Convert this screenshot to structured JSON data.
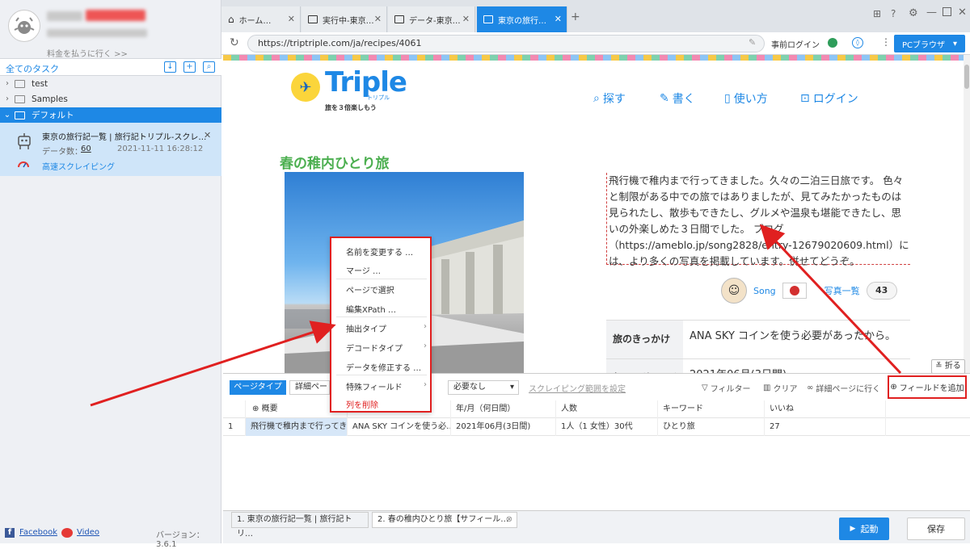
{
  "sidebar": {
    "pay_label": "料金を払うに行く >>",
    "tasks_title": "全てのタスク",
    "folders": [
      {
        "label": "test",
        "expanded": false
      },
      {
        "label": "Samples",
        "expanded": false
      },
      {
        "label": "デフォルト",
        "expanded": true,
        "selected": true
      }
    ],
    "task": {
      "title": "東京の旅行記一覧 | 旅行記トリプル-スクレ…",
      "count_label": "データ数：",
      "count": "60",
      "date": "2021-11-11 16:28:12",
      "mode": "高速スクレイピング"
    },
    "facebook": "Facebook",
    "video": "Video",
    "version": "バージョン：3.6.1"
  },
  "browser": {
    "tabs": [
      {
        "label": "ホーム…",
        "icon": "home-icon",
        "active": false
      },
      {
        "label": "実行中-東京…",
        "icon": "window-icon",
        "active": false
      },
      {
        "label": "データ-東京…",
        "icon": "window-icon",
        "active": false
      },
      {
        "label": "東京の旅行…",
        "icon": "window-icon",
        "active": true
      }
    ],
    "url": "https://triptriple.com/ja/recipes/4061",
    "pre_login": "事前ログイン",
    "browser_mode": "PCブラウザ"
  },
  "webpage": {
    "logo_text": "Triple",
    "logo_sub": "トリプル",
    "logo_tagline": "旅を３倍楽しもう",
    "nav": [
      {
        "label": "探す",
        "icon": "search-icon"
      },
      {
        "label": "書く",
        "icon": "pencil-icon"
      },
      {
        "label": "使い方",
        "icon": "book-icon"
      },
      {
        "label": "ログイン",
        "icon": "lock-icon"
      }
    ],
    "title": "春の稚内ひとり旅",
    "description": "飛行機で稚内まで行ってきました。久々の二泊三日旅です。 色々と制限がある中での旅ではありましたが、見てみたかったものは見られたし、散歩もできたし、グルメや温泉も堪能できたし、思いの外楽しめた３日間でした。 ブログ（https://ameblo.jp/song2828/entry-12679020609.html）には、より多くの写真を掲載しています。併せてどうぞ。",
    "author": "Song",
    "photo_list": "写真一覧",
    "photo_count": "43",
    "info": [
      {
        "key": "旅のきっかけ",
        "value": "ANA SKY コインを使う必要があったから。"
      },
      {
        "key": "年/月（何日間）",
        "value": "2021年06月(3日間)"
      }
    ],
    "fold": "折る"
  },
  "toolbar": {
    "page_type": "ページタイプ",
    "detail_select": "詳細ペー",
    "need_select": "必要なし",
    "scrape_range": "スクレイピング範囲を設定",
    "filter": "フィルター",
    "clear": "クリア",
    "goto_detail": "詳細ページに行く",
    "add_field": "フィールドを追加"
  },
  "context_menu": {
    "items": [
      "名前を変更する …",
      "マージ …",
      "ページで選択",
      "編集XPath …",
      "抽出タイプ",
      "デコードタイプ",
      "データを修正する …",
      "特殊フィールド",
      "列を削除"
    ]
  },
  "grid": {
    "headers": [
      "概要",
      "",
      "年/月（何日間）",
      "人数",
      "キーワード",
      "いいね"
    ],
    "rows": [
      {
        "num": "1",
        "cells": [
          "飛行機で稚内まで行ってき…",
          "ANA SKY コインを使う必…",
          "2021年06月(3日間)",
          "1人（1 女性）30代",
          "ひとり旅",
          "27"
        ]
      }
    ]
  },
  "bottom_tabs": [
    "1. 東京の旅行記一覧 | 旅行記トリ…",
    "2. 春の稚内ひとり旅【サフィール…"
  ],
  "actions": {
    "start": "起動",
    "save": "保存"
  },
  "colors": {
    "accent": "#1e88e5",
    "highlight_red": "#e02020",
    "title_green": "#4caf50"
  }
}
